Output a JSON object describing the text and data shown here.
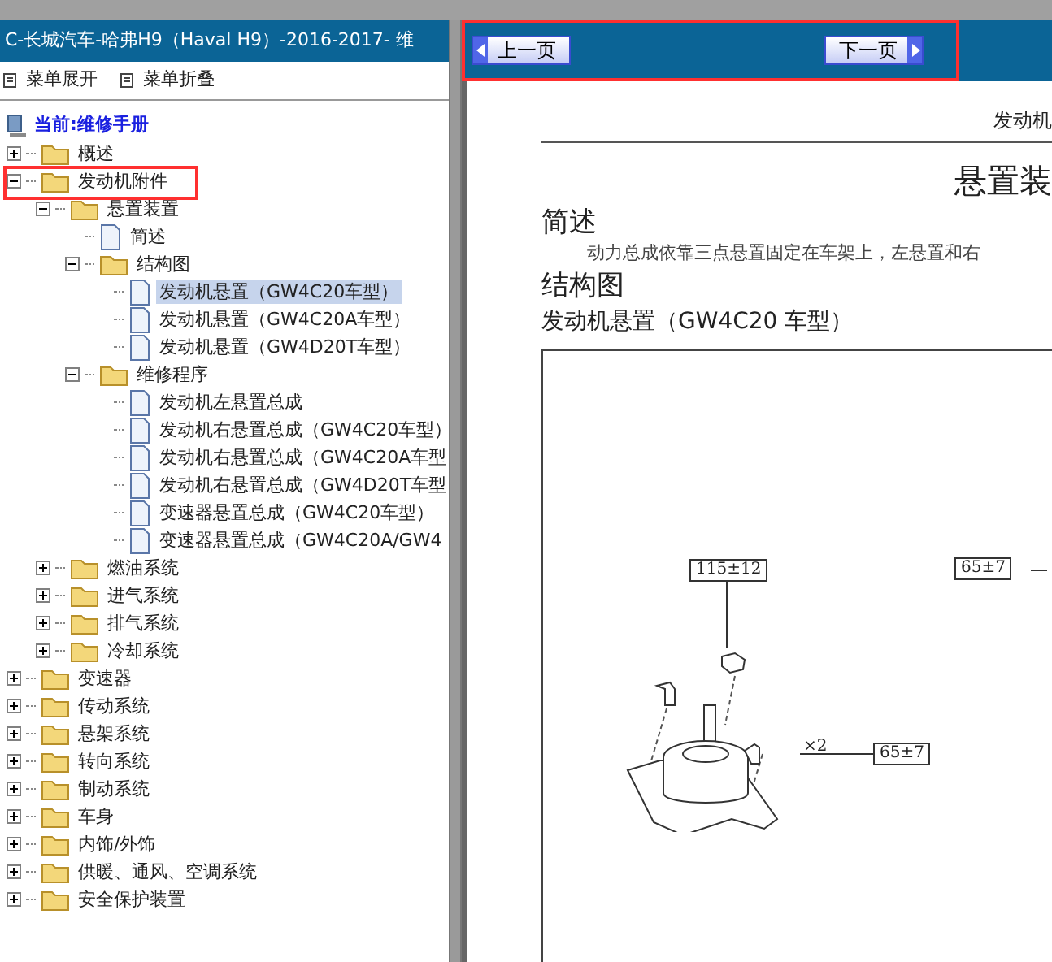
{
  "window": {
    "title": "C-长城汽车-哈弗H9（Haval H9）-2016-2017- 维"
  },
  "toolbar": [
    {
      "label": "菜单展开"
    },
    {
      "label": "菜单折叠"
    }
  ],
  "tree": {
    "root": "当前:维修手册",
    "items": [
      {
        "label": "概述",
        "kind": "folder",
        "expanded": false,
        "selected": false
      },
      {
        "label": "发动机附件",
        "kind": "folder",
        "expanded": true,
        "selected": false,
        "children": [
          {
            "label": "悬置装置",
            "kind": "folder",
            "expanded": true,
            "selected": false,
            "children": [
              {
                "label": "简述",
                "kind": "doc",
                "selected": false
              },
              {
                "label": "结构图",
                "kind": "folder",
                "expanded": true,
                "selected": false,
                "children": [
                  {
                    "label": "发动机悬置（GW4C20车型）",
                    "kind": "doc",
                    "selected": true
                  },
                  {
                    "label": "发动机悬置（GW4C20A车型）",
                    "kind": "doc",
                    "selected": false
                  },
                  {
                    "label": "发动机悬置（GW4D20T车型）",
                    "kind": "doc",
                    "selected": false
                  }
                ]
              },
              {
                "label": "维修程序",
                "kind": "folder",
                "expanded": true,
                "selected": false,
                "children": [
                  {
                    "label": "发动机左悬置总成",
                    "kind": "doc",
                    "selected": false
                  },
                  {
                    "label": "发动机右悬置总成（GW4C20车型）",
                    "kind": "doc",
                    "selected": false
                  },
                  {
                    "label": "发动机右悬置总成（GW4C20A车型",
                    "kind": "doc",
                    "selected": false
                  },
                  {
                    "label": "发动机右悬置总成（GW4D20T车型",
                    "kind": "doc",
                    "selected": false
                  },
                  {
                    "label": "变速器悬置总成（GW4C20车型）",
                    "kind": "doc",
                    "selected": false
                  },
                  {
                    "label": "变速器悬置总成（GW4C20A/GW4",
                    "kind": "doc",
                    "selected": false
                  }
                ]
              }
            ]
          },
          {
            "label": "燃油系统",
            "kind": "folder",
            "expanded": false,
            "selected": false
          },
          {
            "label": "进气系统",
            "kind": "folder",
            "expanded": false,
            "selected": false
          },
          {
            "label": "排气系统",
            "kind": "folder",
            "expanded": false,
            "selected": false
          },
          {
            "label": "冷却系统",
            "kind": "folder",
            "expanded": false,
            "selected": false
          }
        ]
      },
      {
        "label": "变速器",
        "kind": "folder",
        "expanded": false,
        "selected": false
      },
      {
        "label": "传动系统",
        "kind": "folder",
        "expanded": false,
        "selected": false
      },
      {
        "label": "悬架系统",
        "kind": "folder",
        "expanded": false,
        "selected": false
      },
      {
        "label": "转向系统",
        "kind": "folder",
        "expanded": false,
        "selected": false
      },
      {
        "label": "制动系统",
        "kind": "folder",
        "expanded": false,
        "selected": false
      },
      {
        "label": "车身",
        "kind": "folder",
        "expanded": false,
        "selected": false
      },
      {
        "label": "内饰/外饰",
        "kind": "folder",
        "expanded": false,
        "selected": false
      },
      {
        "label": "供暖、通风、空调系统",
        "kind": "folder",
        "expanded": false,
        "selected": false
      },
      {
        "label": "安全保护装置",
        "kind": "folder",
        "expanded": false,
        "selected": false
      }
    ]
  },
  "nav": {
    "prev": "上一页",
    "next": "下一页"
  },
  "page": {
    "header": "发动机",
    "title": "悬置装",
    "section_1": "简述",
    "paragraph": "动力总成依靠三点悬置固定在车架上，左悬置和右",
    "section_2": "结构图",
    "subtitle": "发动机悬置（GW4C20 车型）",
    "diagram_labels": [
      "115±12",
      "65±7",
      "×2",
      "65±7"
    ]
  }
}
